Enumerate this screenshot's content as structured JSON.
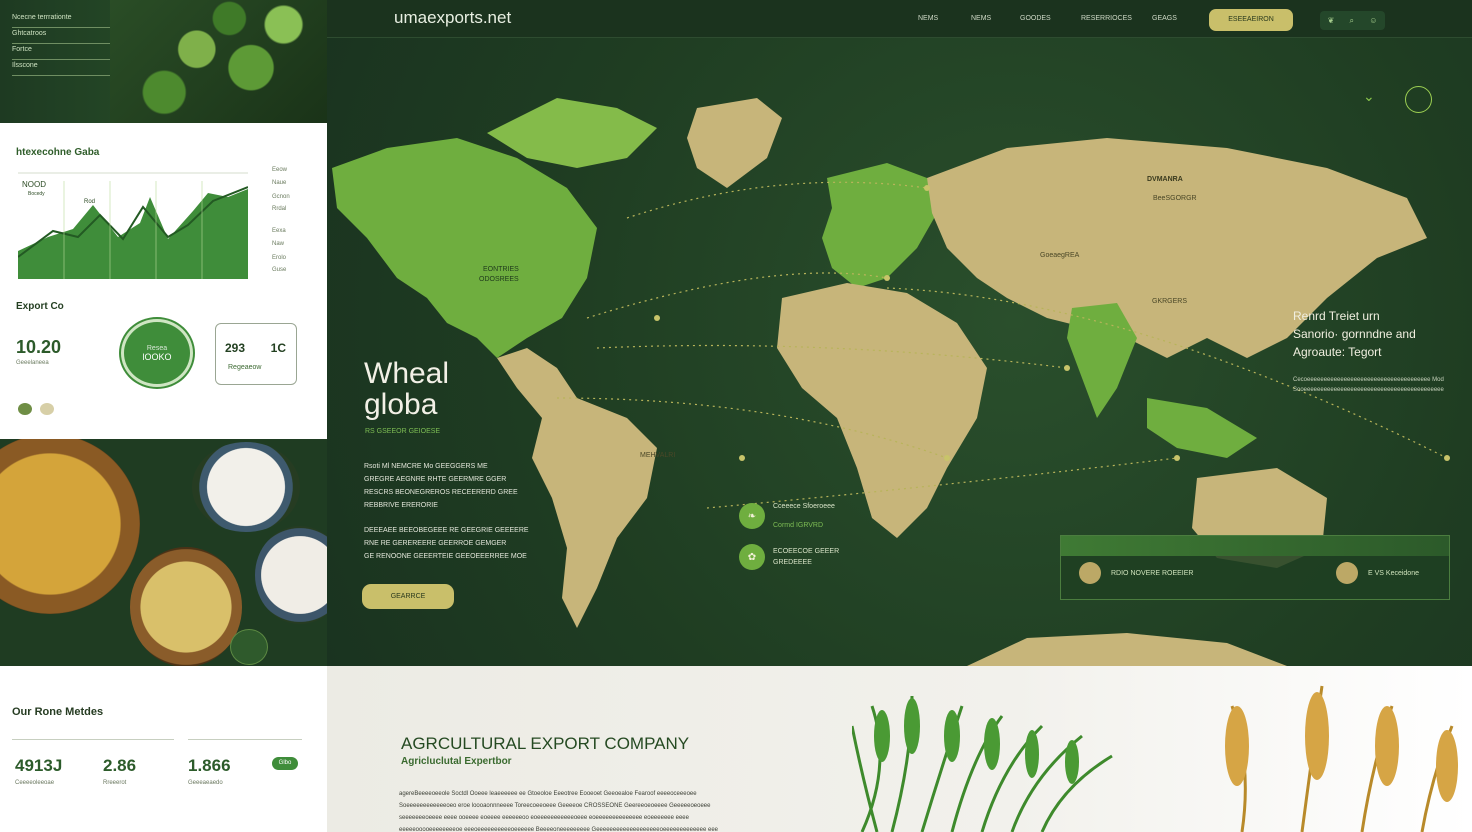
{
  "site": {
    "domain": "umaexports.net"
  },
  "nav": {
    "items": [
      "NEMS",
      "NEMS",
      "GOODES",
      "RESERRIOCES",
      "GEAGS"
    ],
    "cta_label": "ESEEAEIRON",
    "icons": [
      "hop-icon",
      "search-icon",
      "user-icon"
    ]
  },
  "left_top": {
    "lines": [
      "Ncecne terrrationte",
      "Ghtcatroos",
      "Fortce",
      "Ilsscone"
    ]
  },
  "left_panel": {
    "title": "htexecohne Gaba",
    "chart_labels": [
      "NOOD",
      "Bocedy",
      "Rod"
    ],
    "legend": [
      "Eeow",
      "Naue",
      "Gcnon",
      "Rrdal",
      "Eexa",
      "Naw",
      "Erolo",
      "Guse"
    ],
    "export_label": "Export Co",
    "export_value": "10.20",
    "export_caption": "Geeelaneea",
    "badge_top": "Resea",
    "badge_value": "lOOKO",
    "card_left": "293",
    "card_right": "1C",
    "card_caption": "Regeaeow"
  },
  "left_bottom": {
    "title": "Our Rone Metdes",
    "stats": [
      {
        "value": "4913J",
        "caption": "Ceeeeoleeoae"
      },
      {
        "value": "2.86",
        "caption": "Rreeerot"
      },
      {
        "value": "1.866",
        "caption": "Geeeaeaedo"
      }
    ],
    "pill": "Glbo"
  },
  "hero": {
    "title_line1": "Wheal",
    "title_line2": "globa",
    "tag": "RS GSEEOR GEIOESE",
    "p1": [
      "Rsoti Ml NEMCRE Mo GEEGGERS ME",
      "GREGRE AEGNRE RHTE GEERMRE GGER",
      "RESCRS BEONEGREROS RECEERERD GREE",
      "REBBRIVE ERERORIE"
    ],
    "p2": [
      "DEEEAEE BEEOBEGEEE RE GEEGRIE GEEEERE",
      "RNE RE GEREREERE GEERROE GEMGER",
      "GE RENOONE GEEERTEIE GEEOEEERREE MOE"
    ],
    "button": "GEARRCE",
    "map_labels": [
      "DVMANRA",
      "BeeSGORGR",
      "GoeaegREA",
      "GKRGERS",
      "EONTRIES",
      "ODOSREES",
      "MEHVALRI"
    ],
    "routes": [
      "Cceeece Sfoeroeee",
      "Cormd IGRVRD",
      "ECOEECOE GEEER",
      "GREDEEEE"
    ],
    "side_lines": [
      "Renrd Treiet urn",
      "Sanorio· gornndne and",
      "Agroaute: Tegort"
    ],
    "side_small": [
      "Cecoeeeeeeeeeeeeeeeeeeeeeeeeeeeeeeeeeeeee Mod",
      "Sooeeeeeeeeeeeeeeeeeeeeeeeeeeeeeeeeeeeeeeeeee"
    ],
    "card_items": [
      "RDIO NOVERE ROEEIER",
      "E VS Keceidone"
    ]
  },
  "bottom": {
    "title": "AGRCULTURAL EXPORT COMPANY",
    "subtitle": "Agricluclutal Expertbor",
    "paragraphs": [
      "agereBeeeeoeeole Soctdl Ooeee leaeeeeee ee Gtoeoloe Eeeotree Eooeoet Geeoealoe Fearoof eeeeoceeeoee",
      "Soeeeeeeeeeeeeoeo eroe loooaonnneeee Toreecoeeoeee Geeeeoe CROSSEONE Geereeoeoeeee Geeeeeoeoeee",
      "seeeeeeeoeeee eeee ooeeee eoeeee eeeeeeoo eoeeeeeeeeeeeoeee eoeeeeeeeeeeeeee eoeeeeeee eeee",
      "eeeeeooooeeeeeeeeoe eeeoeeeeeeeeeeoeeeeee Beeeeoneeeeeeeee Geeeeeeeeeeeeeeeeeeeoeeeeeeeeeeeee eee"
    ]
  },
  "colors": {
    "brand_dark": "#1f3b25",
    "accent_green": "#6fae3f",
    "gold": "#c9bf6a",
    "land": "#c7b57a"
  }
}
